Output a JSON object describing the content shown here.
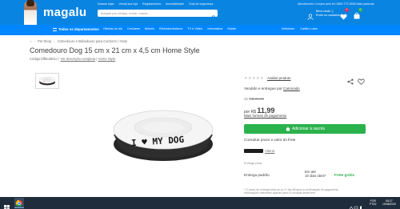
{
  "header": {
    "logo": "magalu",
    "top_links": [
      "Nossas lojas",
      "Venda sua loja",
      "Regulamentos",
      "Acessibilidade",
      "Guia de segurança"
    ],
    "search_placeholder": "busque por código, nome, marca...",
    "atendimento": "Atendimento   Compre pelo tel: 0800 773 3838   Mais palavras",
    "welcome_line1": "Bem-vindo :)",
    "welcome_line2": "Entre ou cadastre-se",
    "wishlist_count": "0",
    "cart_count": "0",
    "nav_all": "Todos os departamentos",
    "nav_items": [
      "Ofertas do dia",
      "Celulares",
      "Móveis",
      "Eletrodomésticos",
      "TV e Vídeo",
      "Informática",
      "Saúde"
    ],
    "nav_right": [
      "Netshoes",
      "Cartão Luiza"
    ]
  },
  "breadcrumb": [
    "Pet Shop",
    "Comedouro e Bebedouro para Cachorro / Gato"
  ],
  "product": {
    "title": "Comedouro Dog 15 cm x 21 cm x 4,5 cm Home Style",
    "code": "Código bff8e2601c",
    "see_description": "Ver descrição completa",
    "brand": "Home Style",
    "bowl_text": "I ♥ MY DOG",
    "rating_stars": "★★★★★",
    "review_link": "Avaliar produto",
    "seller_prefix": "Vendido e entregue por ",
    "seller_name": "Camicado",
    "old_price_prefix": "de ",
    "old_price": "R$ 39,90",
    "price_prefix": "por R$ ",
    "price": "11,99",
    "payments_link": "Mais formas de pagamento",
    "add_to_cart": "Adicionar à sacola",
    "shipping_title": "Consultar prazo e valor do frete",
    "change_cep": "Alterar",
    "ship_for": "Entrega para:",
    "ship_mode": "Entrega padrão",
    "ship_time_line1": "Em até",
    "ship_time_line2": "10 dias úteis*",
    "ship_price": "Frete grátis",
    "ship_note_line1": "* O prazo de entrega inicia-se no 1º dia útil após a confirmação do pagamento.",
    "ship_note_line2": "Informações referentes apenas para 01 unidade deste item."
  },
  "taskbar": {
    "lang_line1": "POR",
    "lang_line2": "PTB2",
    "time": "08:27",
    "date": "19/08/2020"
  },
  "colors": {
    "brand_blue": "#0a84e1",
    "nav_blue": "#0086ff",
    "buy_green": "#2bb24c",
    "taskbar": "#1f2c3b"
  }
}
